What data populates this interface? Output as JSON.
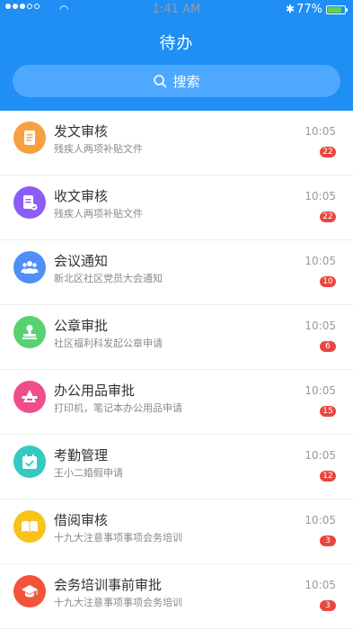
{
  "status_bar": {
    "time": "1:41 AM",
    "battery": "77%",
    "battery_level": 0.77
  },
  "header": {
    "title": "待办",
    "search_label": "搜索"
  },
  "colors": {
    "header_bg": "#1f8ef5",
    "search_bg": "#4ea8ff",
    "badge_bg": "#e9463f"
  },
  "items": [
    {
      "name": "发文审核",
      "subtitle": "残疾人两项补贴文件",
      "time": "10:05",
      "badge": "22",
      "icon": "document-icon",
      "color": "#f6a042"
    },
    {
      "name": "收文审核",
      "subtitle": "残疾人两项补贴文件",
      "time": "10:05",
      "badge": "22",
      "icon": "document-check-icon",
      "color": "#8b5cf6"
    },
    {
      "name": "会议通知",
      "subtitle": "新北区社区党员大会通知",
      "time": "10:05",
      "badge": "10",
      "icon": "people-icon",
      "color": "#4f8ff6"
    },
    {
      "name": "公章审批",
      "subtitle": "社区福利科发起公章申请",
      "time": "10:05",
      "badge": "6",
      "icon": "stamp-icon",
      "color": "#58d271"
    },
    {
      "name": "办公用品审批",
      "subtitle": "打印机，笔记本办公用品申请",
      "time": "10:05",
      "badge": "15",
      "icon": "office-supplies-icon",
      "color": "#f04d8b"
    },
    {
      "name": "考勤管理",
      "subtitle": "王小二婚假申请",
      "time": "10:05",
      "badge": "12",
      "icon": "calendar-check-icon",
      "color": "#35c9c2"
    },
    {
      "name": "借阅审核",
      "subtitle": "十九大注意事项事项会务培训",
      "time": "10:05",
      "badge": "3",
      "icon": "book-icon",
      "color": "#f8c31a"
    },
    {
      "name": "会务培训事前审批",
      "subtitle": "十九大注意事项事项会务培训",
      "time": "10:05",
      "badge": "3",
      "icon": "graduation-cap-icon",
      "color": "#f2533a"
    }
  ]
}
